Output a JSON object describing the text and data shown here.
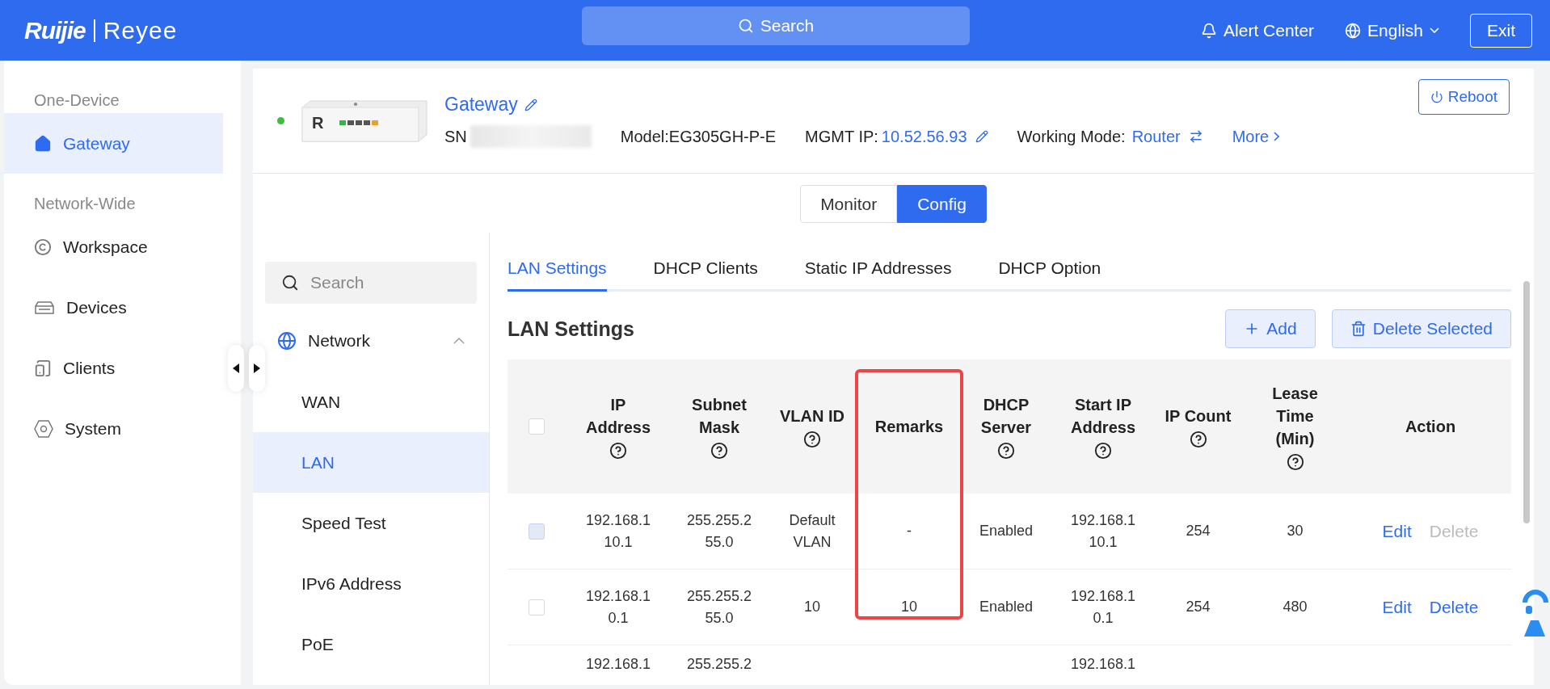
{
  "header": {
    "logo": {
      "brand": "Ruijie",
      "product": "Reyee"
    },
    "search": {
      "placeholder": "Search"
    },
    "alert_center": "Alert Center",
    "language": "English",
    "exit": "Exit"
  },
  "sidebar": {
    "sections": [
      {
        "title": "One-Device",
        "items": [
          {
            "label": "Gateway",
            "selected": true
          }
        ]
      },
      {
        "title": "Network-Wide",
        "items": [
          {
            "label": "Workspace",
            "selected": false
          },
          {
            "label": "Devices",
            "selected": false
          },
          {
            "label": "Clients",
            "selected": false
          },
          {
            "label": "System",
            "selected": false
          }
        ]
      }
    ]
  },
  "device": {
    "online": true,
    "device_label": "R",
    "name": "Gateway",
    "sn_label": "SN",
    "model": "Model:EG305GH-P-E",
    "mgmt_ip_label": "MGMT IP:",
    "mgmt_ip": "10.52.56.93",
    "working_mode_label": "Working Mode:",
    "working_mode": "Router",
    "more": "More",
    "reboot": "Reboot"
  },
  "view_toggle": [
    {
      "label": "Monitor",
      "selected": false
    },
    {
      "label": "Config",
      "selected": true
    }
  ],
  "config_nav": {
    "search": {
      "placeholder": "Search"
    },
    "groups": [
      {
        "label": "Network",
        "expanded": true,
        "children": [
          {
            "label": "WAN",
            "selected": false
          },
          {
            "label": "LAN",
            "selected": true
          },
          {
            "label": "Speed Test",
            "selected": false
          },
          {
            "label": "IPv6 Address",
            "selected": false
          },
          {
            "label": "PoE",
            "selected": false
          }
        ]
      }
    ]
  },
  "tabs": [
    {
      "label": "LAN Settings",
      "selected": true
    },
    {
      "label": "DHCP Clients",
      "selected": false
    },
    {
      "label": "Static IP Addresses",
      "selected": false
    },
    {
      "label": "DHCP Option",
      "selected": false
    }
  ],
  "section": {
    "title": "LAN Settings",
    "add": "Add",
    "delete_selected": "Delete Selected"
  },
  "table": {
    "columns": [
      {
        "label": "IP Address",
        "help": true,
        "highlighted": false
      },
      {
        "label": "Subnet Mask",
        "help": true,
        "highlighted": false
      },
      {
        "label": "VLAN ID",
        "help": true,
        "highlighted": false
      },
      {
        "label": "Remarks",
        "help": false,
        "highlighted": true
      },
      {
        "label": "DHCP Server",
        "help": true,
        "highlighted": false
      },
      {
        "label": "Start IP Address",
        "help": true,
        "highlighted": false
      },
      {
        "label": "IP Count",
        "help": true,
        "highlighted": false
      },
      {
        "label": "Lease Time (Min)",
        "help": true,
        "highlighted": false
      },
      {
        "label": "Action",
        "help": false,
        "highlighted": false
      }
    ],
    "header_checked": false,
    "rows": [
      {
        "checked": false,
        "disabled": true,
        "cells": [
          "192.168.110.1",
          "255.255.255.0",
          "Default VLAN",
          "-",
          "Enabled",
          "192.168.110.1",
          "254",
          "30"
        ],
        "actions": [
          {
            "label": "Edit",
            "disabled": false
          },
          {
            "label": "Delete",
            "disabled": true
          }
        ]
      },
      {
        "checked": false,
        "disabled": false,
        "cells": [
          "192.168.10.1",
          "255.255.255.0",
          "10",
          "10",
          "Enabled",
          "192.168.10.1",
          "254",
          "480"
        ],
        "actions": [
          {
            "label": "Edit",
            "disabled": false
          },
          {
            "label": "Delete",
            "disabled": false
          }
        ]
      },
      {
        "cut": true,
        "cells": [
          "192.168.1",
          "255.255.2",
          null,
          null,
          null,
          "192.168.1",
          null,
          null
        ]
      }
    ]
  }
}
